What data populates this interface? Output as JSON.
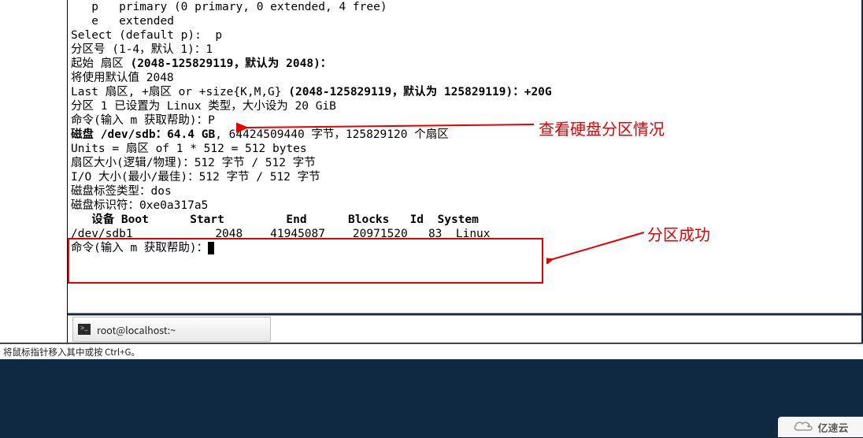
{
  "terminal": {
    "line01": "   p   primary (0 primary, 0 extended, 4 free)",
    "line02": "   e   extended",
    "line03": "Select (default p):  p",
    "line04": "分区号 (1-4，默认 1)：1",
    "line05_a": "起始 扇区 ",
    "line05_b": "(2048-125829119，默认为 2048)：",
    "line06": "将使用默认值 2048",
    "line07_a": "Last 扇区, +扇区 or +size{K,M,G} ",
    "line07_b": "(2048-125829119，默认为 125829119)：+20G",
    "line08": "分区 1 已设置为 Linux 类型，大小设为 20 GiB",
    "line09": "",
    "line10": "命令(输入 m 获取帮助)：P",
    "line11": "",
    "line12_a": "磁盘 /dev/sdb：64.4 GB",
    "line12_b": ", 64424509440 字节，125829120 个扇区",
    "line13": "Units = 扇区 of 1 * 512 = 512 bytes",
    "line14": "扇区大小(逻辑/物理)：512 字节 / 512 字节",
    "line15": "I/O 大小(最小/最佳)：512 字节 / 512 字节",
    "line16": "磁盘标签类型：dos",
    "line17": "磁盘标识符：0xe0a317a5",
    "line18": "",
    "line19": "   设备 Boot      Start         End      Blocks   Id  System",
    "line20": "/dev/sdb1            2048    41945087    20971520   83  Linux",
    "line21": "",
    "line22": "命令(输入 m 获取帮助)："
  },
  "annotation": {
    "view_partition": "查看硬盘分区情况",
    "partition_success": "分区成功"
  },
  "taskbar": {
    "terminal_title": "root@localhost:~"
  },
  "hint": "将鼠标指针移入其中或按 Ctrl+G。",
  "watermark": "亿速云"
}
